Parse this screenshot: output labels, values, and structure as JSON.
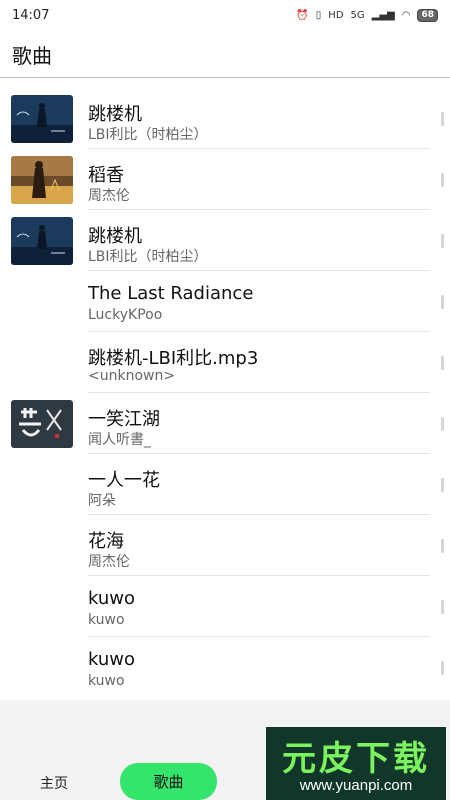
{
  "status_bar": {
    "time": "14:07",
    "network": "5G",
    "battery": "68"
  },
  "header": {
    "title": "歌曲"
  },
  "songs": [
    {
      "title": "跳楼机",
      "artist": "LBI利比（时柏尘）",
      "cover": "dark-blue-cover"
    },
    {
      "title": "稻香",
      "artist": "周杰伦",
      "cover": "golden-field-cover"
    },
    {
      "title": "跳楼机",
      "artist": "LBI利比（时柏尘）",
      "cover": "dark-blue-cover"
    },
    {
      "title": "The Last Radiance",
      "artist": "LuckyKPoo",
      "cover": ""
    },
    {
      "title": "跳楼机-LBI利比.mp3",
      "artist": "<unknown>",
      "cover": ""
    },
    {
      "title": "一笑江湖",
      "artist": "闻人听書_",
      "cover": "calligraphy-cover"
    },
    {
      "title": "一人一花",
      "artist": "阿朵",
      "cover": ""
    },
    {
      "title": "花海",
      "artist": "周杰伦",
      "cover": ""
    },
    {
      "title": "kuwo",
      "artist": "kuwo",
      "cover": ""
    },
    {
      "title": "kuwo",
      "artist": "kuwo",
      "cover": ""
    }
  ],
  "bottom_nav": {
    "home": "主页",
    "songs": "歌曲",
    "active_color": "#35e46a"
  },
  "watermark": {
    "text": "元皮下载",
    "url": "www.yuanpi.com"
  }
}
